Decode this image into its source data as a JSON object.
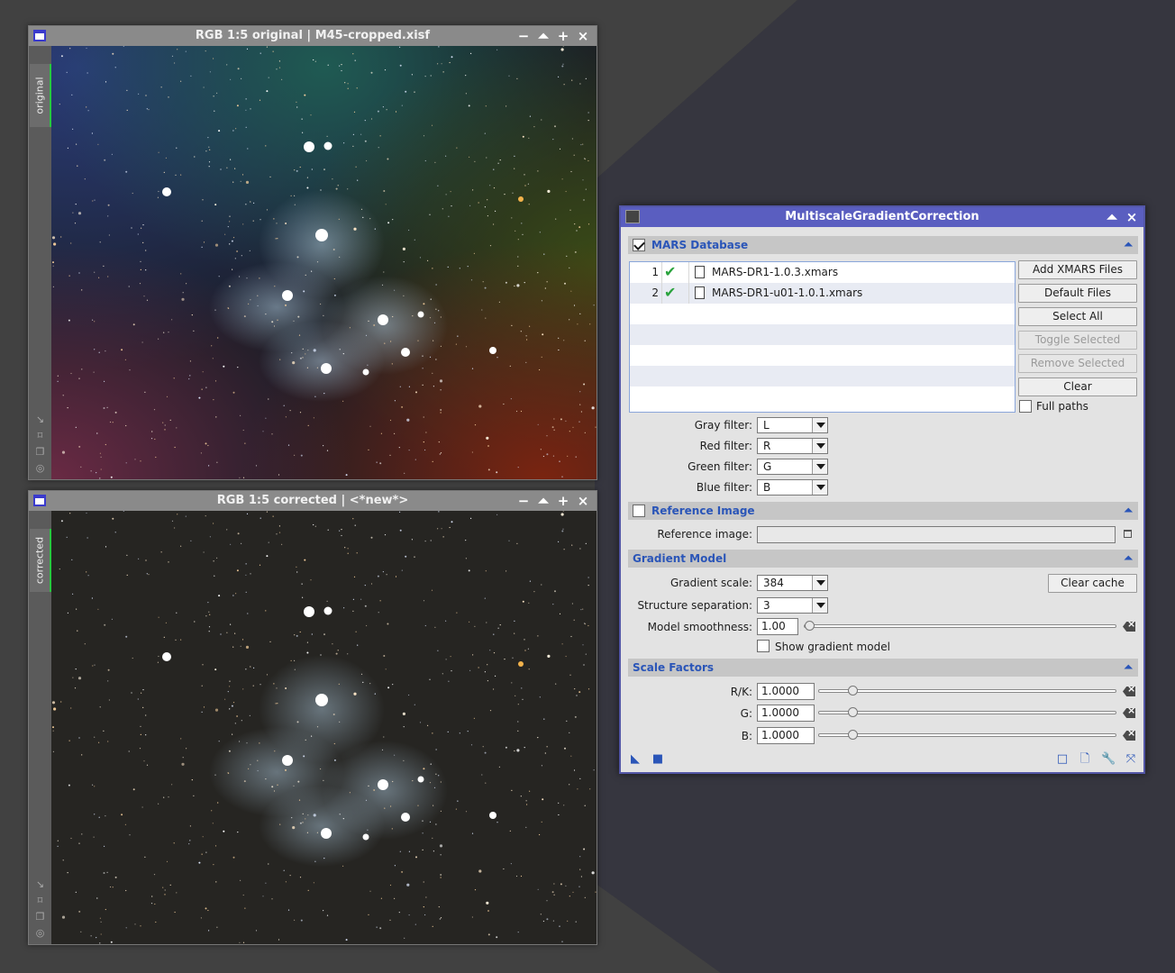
{
  "windows": {
    "original": {
      "title": "RGB 1:5 original | M45-cropped.xisf",
      "tab_label": "original"
    },
    "corrected": {
      "title": "RGB 1:5 corrected | <*new*>",
      "tab_label": "corrected"
    }
  },
  "window_buttons": {
    "minimize": "−",
    "shade": "⏶",
    "maximize": "+",
    "close": "×"
  },
  "mgc": {
    "title": "MultiscaleGradientCorrection",
    "mars": {
      "section_label": "MARS Database",
      "enabled": true,
      "files": [
        {
          "num": "1",
          "name": "MARS-DR1-1.0.3.xmars"
        },
        {
          "num": "2",
          "name": "MARS-DR1-u01-1.0.1.xmars"
        }
      ],
      "buttons": {
        "add": "Add XMARS Files",
        "default": "Default Files",
        "select_all": "Select All",
        "toggle": "Toggle Selected",
        "remove": "Remove Selected",
        "clear": "Clear"
      },
      "full_paths_label": "Full paths",
      "filters": {
        "gray_label": "Gray filter:",
        "gray_value": "L",
        "red_label": "Red filter:",
        "red_value": "R",
        "green_label": "Green filter:",
        "green_value": "G",
        "blue_label": "Blue filter:",
        "blue_value": "B"
      }
    },
    "reference": {
      "section_label": "Reference Image",
      "label": "Reference image:",
      "value": ""
    },
    "gradient": {
      "section_label": "Gradient Model",
      "scale_label": "Gradient scale:",
      "scale_value": "384",
      "clear_cache": "Clear cache",
      "separation_label": "Structure separation:",
      "separation_value": "3",
      "smoothness_label": "Model smoothness:",
      "smoothness_value": "1.00",
      "smoothness_level": 0.0,
      "show_model_label": "Show gradient model"
    },
    "scale": {
      "section_label": "Scale Factors",
      "rk_label": "R/K:",
      "rk_value": "1.0000",
      "g_label": "G:",
      "g_value": "1.0000",
      "b_label": "B:",
      "b_value": "1.0000",
      "level": 0.1
    }
  },
  "colors": {
    "accent": "#2a55b8",
    "dialog_title": "#5a5ec0",
    "check_green": "#2aa33d"
  }
}
